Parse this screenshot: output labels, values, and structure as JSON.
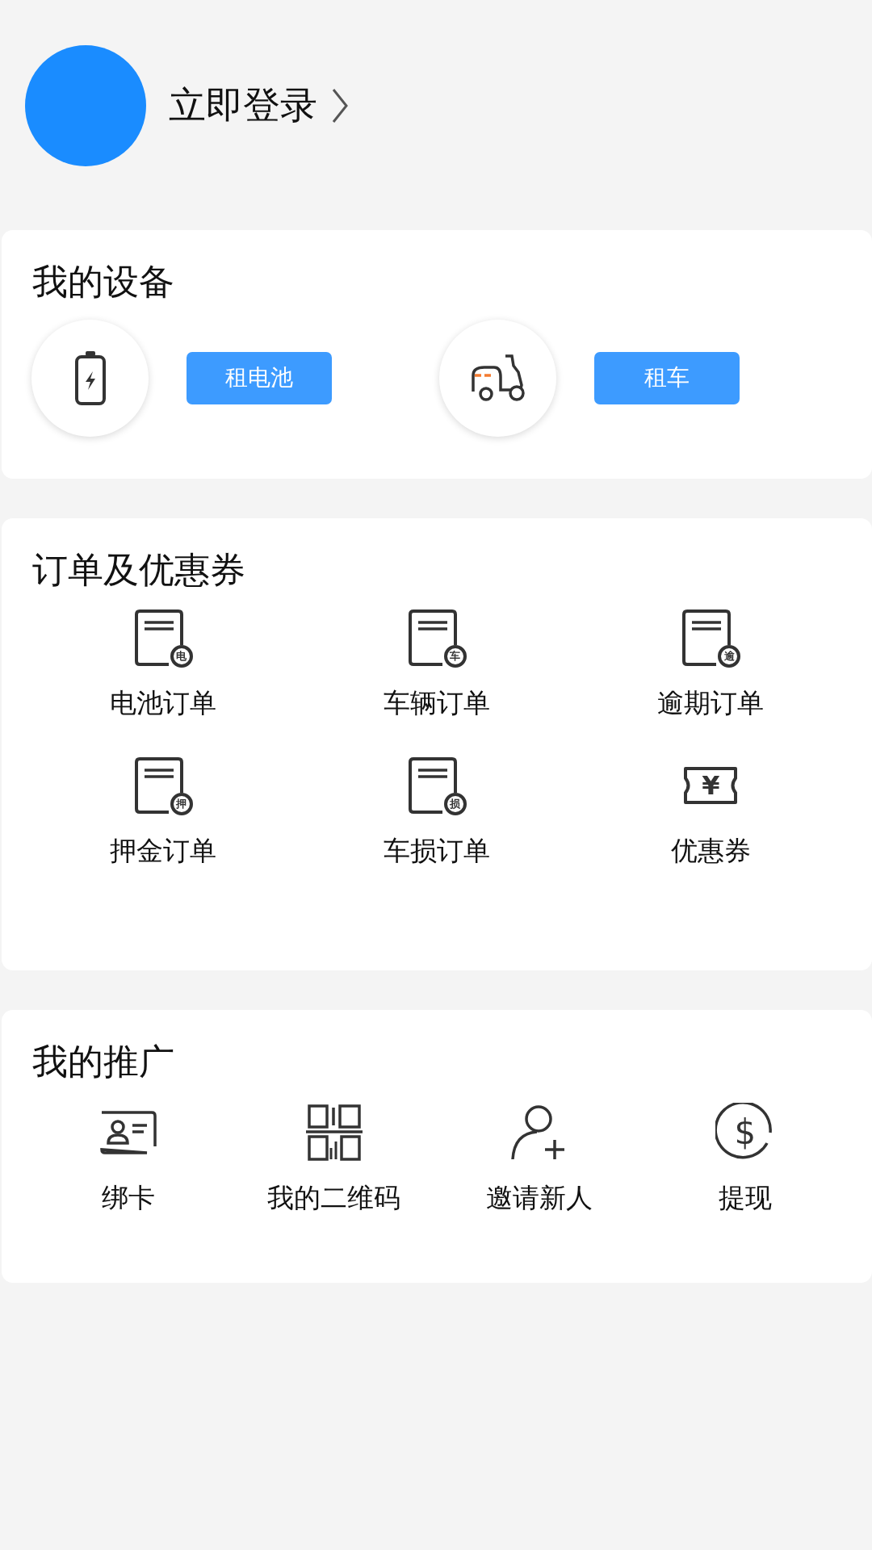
{
  "profile": {
    "login_label": "立即登录"
  },
  "devices": {
    "title": "我的设备",
    "items": [
      {
        "kind": "battery",
        "button": "租电池"
      },
      {
        "kind": "scooter",
        "button": "租车"
      }
    ]
  },
  "orders": {
    "title": "订单及优惠券",
    "items": [
      {
        "kind": "order",
        "badge": "电",
        "label": "电池订单"
      },
      {
        "kind": "order",
        "badge": "车",
        "label": "车辆订单"
      },
      {
        "kind": "order",
        "badge": "逾",
        "label": "逾期订单"
      },
      {
        "kind": "order",
        "badge": "押",
        "label": "押金订单"
      },
      {
        "kind": "order",
        "badge": "损",
        "label": "车损订单"
      },
      {
        "kind": "coupon",
        "badge": "¥",
        "label": "优惠券"
      }
    ]
  },
  "promotion": {
    "title": "我的推广",
    "items": [
      {
        "kind": "card",
        "label": "绑卡"
      },
      {
        "kind": "qrcode",
        "label": "我的二维码"
      },
      {
        "kind": "invite",
        "label": "邀请新人"
      },
      {
        "kind": "withdraw",
        "badge": "$",
        "label": "提现"
      }
    ]
  }
}
